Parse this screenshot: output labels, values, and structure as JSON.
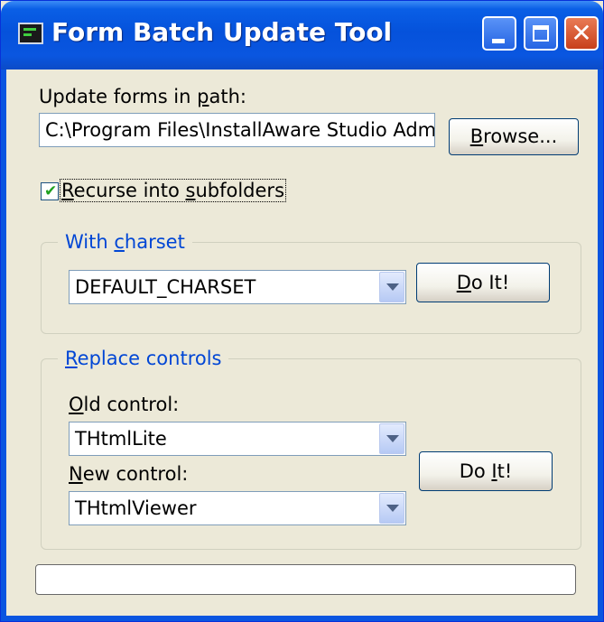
{
  "window": {
    "title": "Form Batch Update Tool",
    "icon": "app-console-icon",
    "controls": {
      "minimize": "minimize-icon",
      "maximize": "maximize-icon",
      "close": "close-icon"
    }
  },
  "path": {
    "label_pre": "Update forms in ",
    "label_acc": "p",
    "label_post": "ath:",
    "value": "C:\\Program Files\\InstallAware Studio Admin",
    "browse_acc": "B",
    "browse_post": "rowse..."
  },
  "recurse": {
    "checked": true,
    "label_acc": "R",
    "label_mid": "ecurse into ",
    "label_acc2": "s",
    "label_post": "ubfolders"
  },
  "charset_group": {
    "title_pre": "With ",
    "title_acc": "c",
    "title_post": "harset",
    "selected": "DEFAULT_CHARSET",
    "doit_acc": "D",
    "doit_post": "o It!"
  },
  "replace_group": {
    "title_acc": "R",
    "title_post": "eplace controls",
    "old_label_acc": "O",
    "old_label_post": "ld control:",
    "old_selected": "THtmlLite",
    "new_label_acc": "N",
    "new_label_post": "ew control:",
    "new_selected": "THtmlViewer",
    "doit_pre": "Do ",
    "doit_acc": "I",
    "doit_post": "t!"
  },
  "progress": {
    "value": 0
  },
  "colors": {
    "titlebar": "#0552db",
    "face": "#ece9d8",
    "group_title": "#0046d5",
    "check": "#21a121"
  }
}
